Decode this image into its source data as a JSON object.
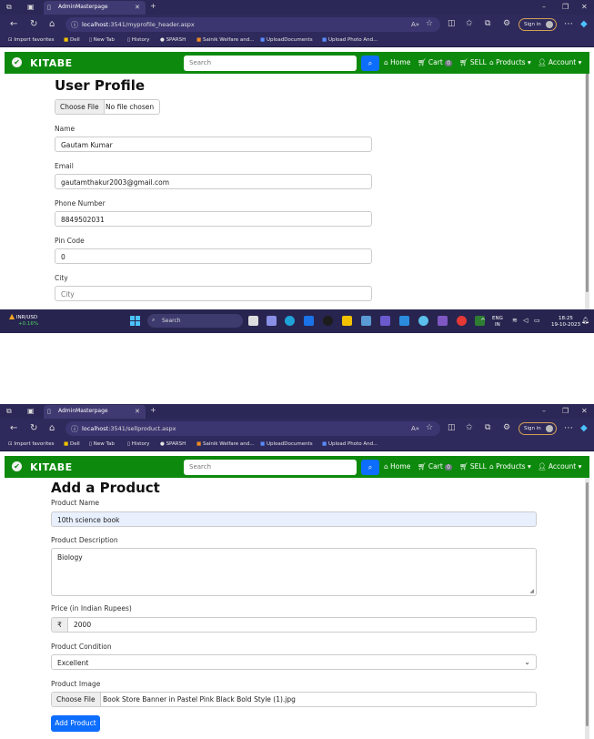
{
  "shots": [
    {
      "browser": {
        "tab_title": "AdminMasterpage",
        "url_prefix": "localhost",
        "url_rest": ":3541/myprofile_header.aspx",
        "signin_label": "Sign in",
        "bookmarks": [
          "Import favorites",
          "Dell",
          "New Tab",
          "History",
          "SPARSH",
          "Sainik Welfare and...",
          "UploadDocuments",
          "Upload Photo And..."
        ]
      },
      "site_nav": {
        "brand": "KITABE",
        "search_placeholder": "Search",
        "home": "Home",
        "cart": "Cart",
        "cart_count": "0",
        "sell": "SELL",
        "products": "Products",
        "account": "Account"
      },
      "form": {
        "title": "User Profile",
        "file_button": "Choose File",
        "file_status": "No file chosen",
        "name_label": "Name",
        "name_value": "Gautam Kumar",
        "email_label": "Email",
        "email_value": "gautamthakur2003@gmail.com",
        "phone_label": "Phone Number",
        "phone_value": "8849502031",
        "pin_label": "Pin Code",
        "pin_value": "0",
        "city_label": "City",
        "city_placeholder": "City"
      },
      "taskbar": {
        "ticker": "INR/USD",
        "ticker_change": "+0.16%",
        "search": "Search",
        "lang": "ENG",
        "region": "IN",
        "time": "18:25",
        "date": "19-10-2023"
      }
    },
    {
      "browser": {
        "tab_title": "AdminMasterpage",
        "url_prefix": "localhost",
        "url_rest": ":3541/sellproduct.aspx",
        "signin_label": "Sign in",
        "bookmarks": [
          "Import favorites",
          "Dell",
          "New Tab",
          "History",
          "SPARSH",
          "Sainik Welfare and...",
          "UploadDocuments",
          "Upload Photo And..."
        ]
      },
      "site_nav": {
        "brand": "KITABE",
        "search_placeholder": "Search",
        "home": "Home",
        "cart": "Cart",
        "cart_count": "0",
        "sell": "SELL",
        "products": "Products",
        "account": "Account"
      },
      "form": {
        "title": "Add a Product",
        "product_name_label": "Product Name",
        "product_name_value": "10th science book",
        "description_label": "Product Description",
        "description_value": "Biology",
        "price_label": "Price (in Indian Rupees)",
        "currency_symbol": "₹",
        "price_value": "2000",
        "condition_label": "Product Condition",
        "condition_value": "Excellent",
        "image_label": "Product Image",
        "file_button": "Choose File",
        "file_name": "Book Store Banner in Pastel Pink Black Bold Style (1).jpg",
        "submit": "Add Product"
      }
    }
  ]
}
